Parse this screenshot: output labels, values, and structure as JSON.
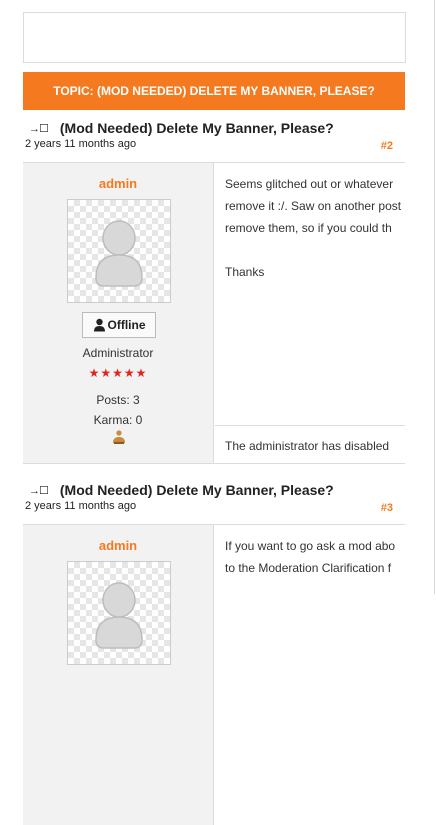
{
  "topic": {
    "label": "TOPIC: (MOD NEEDED) DELETE MY BANNER, PLEASE?"
  },
  "posts": [
    {
      "title": "(Mod Needed) Delete My Banner, Please?",
      "date": "2 years 11 months ago",
      "number": "#2",
      "user": {
        "name": "admin",
        "status": "Offline",
        "role": "Administrator",
        "stars": "★★★★★",
        "posts": "Posts: 3",
        "karma": "Karma: 0"
      },
      "message": "Seems glitched out or whatever\nremove it :/. Saw on another post\nremove them, so if you could th\n\nThanks",
      "signature": "The administrator has disabled"
    },
    {
      "title": "(Mod Needed) Delete My Banner, Please?",
      "date": "2 years 11 months ago",
      "number": "#3",
      "user": {
        "name": "admin"
      },
      "message": "If you want to go ask a mod abo\nto the Moderation Clarification f"
    }
  ],
  "colors": {
    "accent": "#f57a1f",
    "stars": "#e2241c"
  },
  "icons": {
    "post_link": "link-arrow-icon",
    "status": "person-icon",
    "gender": "gender-icon"
  }
}
